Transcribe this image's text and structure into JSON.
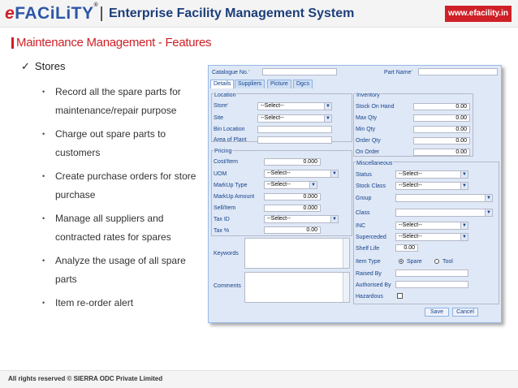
{
  "header": {
    "logo_e": "e",
    "logo_rest": "FACiLiTY",
    "logo_reg": "®",
    "title": "Enterprise Facility Management System",
    "website": "www.efacility.in"
  },
  "section": {
    "title": "Maintenance Management - Features",
    "check_item": "Stores",
    "bullets": [
      "Record all the spare parts for maintenance/repair purpose",
      "Charge out spare parts to customers",
      "Create purchase orders for store purchase",
      "Manage all suppliers and contracted rates for spares",
      "Analyze the usage of all spare parts",
      "Item re-order alert"
    ]
  },
  "footer": {
    "text": "All rights reserved © SIERRA ODC Private Limited"
  },
  "form": {
    "catalogue_label": "Catalogue No.",
    "part_name_label": "Part Name",
    "tabs": [
      "Details",
      "Suppliers",
      "Picture",
      "Dgcs"
    ],
    "location": {
      "legend": "Location",
      "store_label": "Store",
      "store_value": "--Select--",
      "site_label": "Site",
      "site_value": "--Select--",
      "bin_label": "Bin Location",
      "area_label": "Area of Plant"
    },
    "pricing": {
      "legend": "Pricing",
      "cost_label": "Cost/Item",
      "cost_value": "0.000",
      "uom_label": "UOM",
      "uom_value": "--Select--",
      "markup_type_label": "MarkUp Type",
      "markup_type_value": "--Select--",
      "markup_amount_label": "MarkUp Amount",
      "markup_amount_value": "0.000",
      "sell_label": "Sell/Item",
      "sell_value": "0.000",
      "tax_id_label": "Tax ID",
      "tax_id_value": "--Select--",
      "tax_pct_label": "Tax %",
      "tax_pct_value": "0.00"
    },
    "keywords_label": "Keywords",
    "comments_label": "Comments",
    "inventory": {
      "legend": "Inventory",
      "stock_on_hand_label": "Stock On Hand",
      "stock_on_hand_value": "0.00",
      "max_qty_label": "Max Qty",
      "max_qty_value": "0.00",
      "min_qty_label": "Min Qty",
      "min_qty_value": "0.00",
      "order_qty_label": "Order Qty",
      "order_qty_value": "0.00",
      "on_order_label": "On Order",
      "on_order_value": "0.00"
    },
    "misc": {
      "legend": "Miscellaneous",
      "status_label": "Status",
      "status_value": "--Select--",
      "stock_class_label": "Stock Class",
      "stock_class_value": "--Select--",
      "group_label": "Group",
      "class_label": "Class",
      "inc_label": "INC",
      "inc_value": "--Select--",
      "superceded_label": "Superceded",
      "superceded_value": "--Select--",
      "shelf_life_label": "Shelf Life",
      "shelf_life_value": "0.00",
      "item_type_label": "Item Type",
      "item_type_spare": "Spare",
      "item_type_tool": "Tool",
      "raised_by_label": "Raised By",
      "authorised_by_label": "Authorised By",
      "hazardous_label": "Hazardous"
    },
    "save_label": "Save",
    "cancel_label": "Cancel"
  }
}
